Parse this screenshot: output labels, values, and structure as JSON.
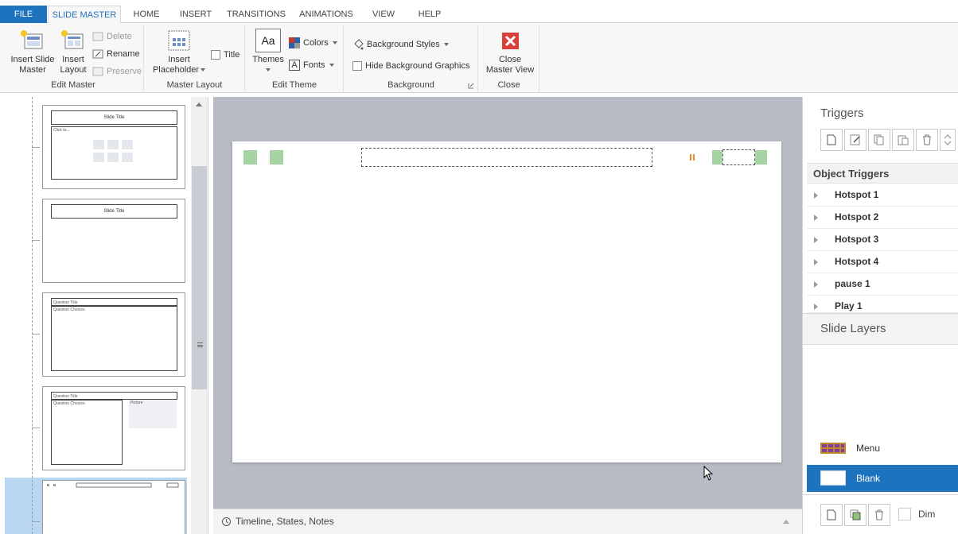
{
  "tabs": [
    {
      "label": "FILE"
    },
    {
      "label": "SLIDE MASTER"
    },
    {
      "label": "HOME"
    },
    {
      "label": "INSERT"
    },
    {
      "label": "TRANSITIONS"
    },
    {
      "label": "ANIMATIONS"
    },
    {
      "label": "VIEW"
    },
    {
      "label": "HELP"
    }
  ],
  "ribbon": {
    "edit_master": {
      "label": "Edit Master",
      "insert_slide_master_1": "Insert Slide",
      "insert_slide_master_2": "Master",
      "insert_layout_1": "Insert",
      "insert_layout_2": "Layout",
      "delete": "Delete",
      "rename": "Rename",
      "preserve": "Preserve"
    },
    "master_layout": {
      "label": "Master Layout",
      "insert_placeholder_1": "Insert",
      "insert_placeholder_2": "Placeholder",
      "title": "Title"
    },
    "edit_theme": {
      "label": "Edit Theme",
      "themes": "Themes",
      "themes_icon_text": "Aa",
      "colors": "Colors",
      "fonts": "Fonts",
      "fonts_icon_text": "A"
    },
    "background": {
      "label": "Background",
      "background_styles": "Background Styles",
      "hide_background_graphics": "Hide Background Graphics"
    },
    "close": {
      "label": "Close",
      "close_master_view_1": "Close",
      "close_master_view_2": "Master View"
    }
  },
  "thumbnails": [
    {
      "title": "Slide Title",
      "body": "Click to..."
    },
    {
      "title": "Slide Title"
    },
    {
      "title": "Question Title",
      "body": "Question Choices"
    },
    {
      "title": "Question Title",
      "body": "Question Choices",
      "side": "Picture"
    }
  ],
  "bottom_bar": {
    "label": "Timeline, States, Notes"
  },
  "triggers_panel": {
    "title": "Triggers",
    "object_triggers": "Object Triggers",
    "items": [
      "Hotspot 1",
      "Hotspot 2",
      "Hotspot 3",
      "Hotspot 4",
      "pause 1",
      "Play 1"
    ]
  },
  "layers_panel": {
    "title": "Slide Layers",
    "layers": [
      {
        "name": "Menu"
      },
      {
        "name": "Blank"
      }
    ],
    "dim": "Dim"
  },
  "colors": {
    "accent": "#1e73be",
    "hotspot_green": "#a6d3a3",
    "pause_orange": "#f08a24",
    "close_red": "#d9403a"
  }
}
